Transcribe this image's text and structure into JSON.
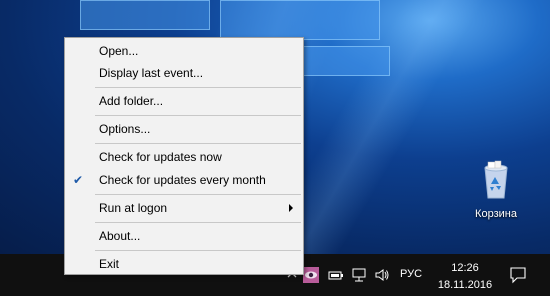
{
  "context_menu": {
    "items": [
      {
        "label": "Open..."
      },
      {
        "label": "Display last event..."
      },
      {
        "label": "Add folder..."
      },
      {
        "label": "Options..."
      },
      {
        "label": "Check for updates now"
      },
      {
        "label": "Check for updates every month",
        "checked": true,
        "check_glyph": "✔"
      },
      {
        "label": "Run at logon",
        "submenu": true
      },
      {
        "label": "About..."
      },
      {
        "label": "Exit"
      }
    ]
  },
  "desktop": {
    "recycle_bin_label": "Корзина"
  },
  "taskbar": {
    "language": "РУС",
    "clock_time": "12:26",
    "clock_date": "18.11.2016",
    "tray_icons": [
      "chevron-up-icon",
      "app-eye-icon",
      "battery-icon",
      "network-icon",
      "volume-icon",
      "notification-icon"
    ]
  },
  "colors": {
    "menu_bg": "#f2f2f2",
    "menu_border": "#a0a0a0",
    "check_color": "#1e5aa8",
    "taskbar_bg": "#101010"
  }
}
